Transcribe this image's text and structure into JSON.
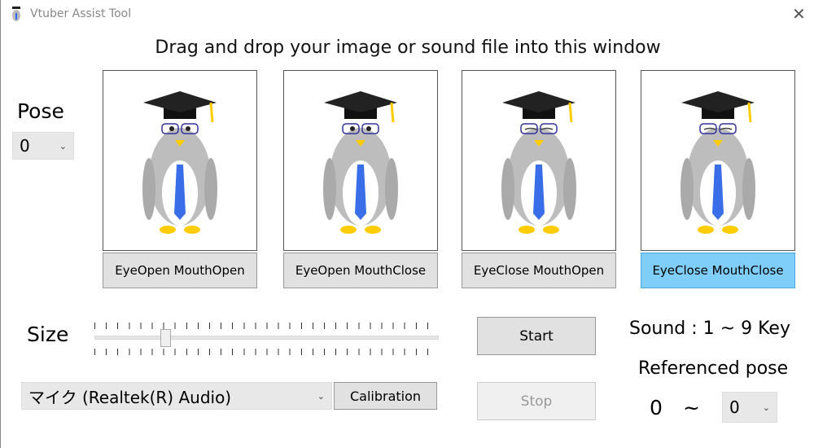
{
  "window": {
    "title": "Vtuber Assist Tool",
    "close_icon": "close-icon"
  },
  "headline": "Drag and drop your image or sound file into this window",
  "pose": {
    "label": "Pose",
    "value": "0"
  },
  "panels": [
    {
      "label": "EyeOpen MouthOpen",
      "eyes": "open",
      "selected": false
    },
    {
      "label": "EyeOpen MouthClose",
      "eyes": "open",
      "selected": false
    },
    {
      "label": "EyeClose MouthOpen",
      "eyes": "closed",
      "selected": false
    },
    {
      "label": "EyeClose MouthClose",
      "eyes": "closed",
      "selected": true
    }
  ],
  "size": {
    "label": "Size",
    "slider_fraction": 0.2
  },
  "audio": {
    "device": "マイク (Realtek(R) Audio)",
    "calibration": "Calibration"
  },
  "controls": {
    "start": "Start",
    "stop": "Stop"
  },
  "sound": {
    "label": "Sound : 1 ~ 9 Key",
    "referenced": "Referenced pose",
    "from": "0",
    "tilde": "~",
    "to": "0"
  },
  "colors": {
    "selected": "#7fcdf9"
  }
}
